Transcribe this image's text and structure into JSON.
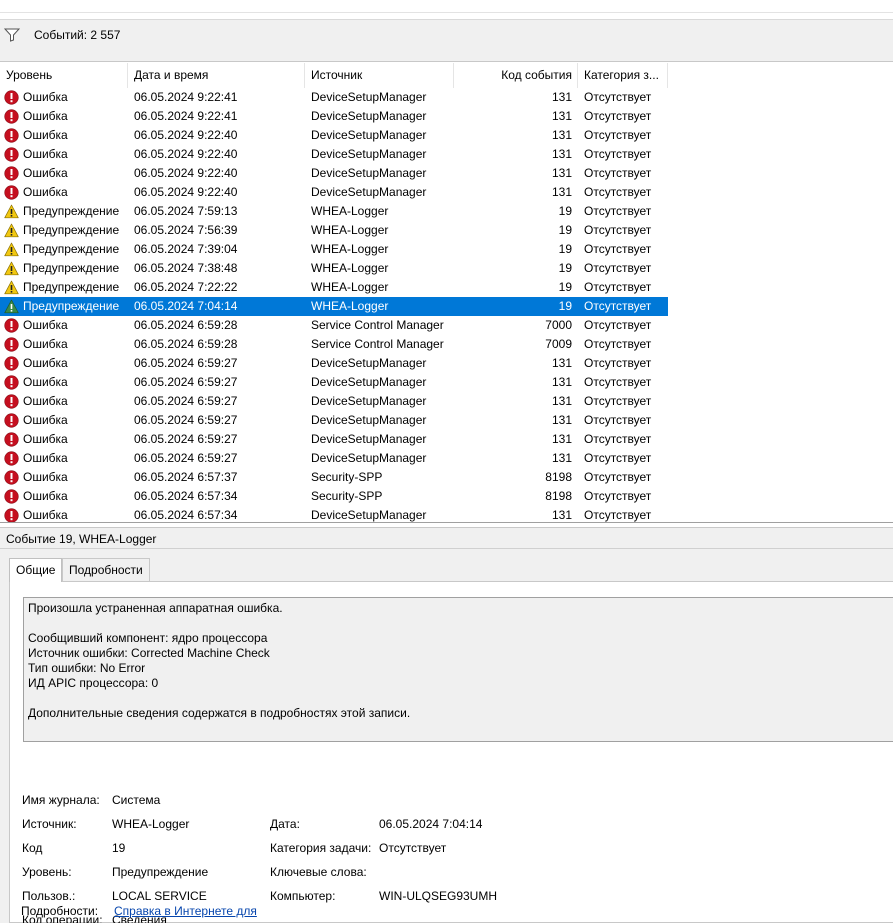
{
  "filter": {
    "icon": "filter-icon",
    "events_count": "Событий: 2 557"
  },
  "table": {
    "headers": {
      "level": "Уровень",
      "date": "Дата и время",
      "source": "Источник",
      "code": "Код события",
      "category": "Категория з..."
    },
    "rows": [
      {
        "level": "Ошибка",
        "type": "error",
        "date": "06.05.2024 9:22:41",
        "source": "DeviceSetupManager",
        "code": "131",
        "category": "Отсутствует"
      },
      {
        "level": "Ошибка",
        "type": "error",
        "date": "06.05.2024 9:22:41",
        "source": "DeviceSetupManager",
        "code": "131",
        "category": "Отсутствует"
      },
      {
        "level": "Ошибка",
        "type": "error",
        "date": "06.05.2024 9:22:40",
        "source": "DeviceSetupManager",
        "code": "131",
        "category": "Отсутствует"
      },
      {
        "level": "Ошибка",
        "type": "error",
        "date": "06.05.2024 9:22:40",
        "source": "DeviceSetupManager",
        "code": "131",
        "category": "Отсутствует"
      },
      {
        "level": "Ошибка",
        "type": "error",
        "date": "06.05.2024 9:22:40",
        "source": "DeviceSetupManager",
        "code": "131",
        "category": "Отсутствует"
      },
      {
        "level": "Ошибка",
        "type": "error",
        "date": "06.05.2024 9:22:40",
        "source": "DeviceSetupManager",
        "code": "131",
        "category": "Отсутствует"
      },
      {
        "level": "Предупреждение",
        "type": "warning",
        "date": "06.05.2024 7:59:13",
        "source": "WHEA-Logger",
        "code": "19",
        "category": "Отсутствует"
      },
      {
        "level": "Предупреждение",
        "type": "warning",
        "date": "06.05.2024 7:56:39",
        "source": "WHEA-Logger",
        "code": "19",
        "category": "Отсутствует"
      },
      {
        "level": "Предупреждение",
        "type": "warning",
        "date": "06.05.2024 7:39:04",
        "source": "WHEA-Logger",
        "code": "19",
        "category": "Отсутствует"
      },
      {
        "level": "Предупреждение",
        "type": "warning",
        "date": "06.05.2024 7:38:48",
        "source": "WHEA-Logger",
        "code": "19",
        "category": "Отсутствует"
      },
      {
        "level": "Предупреждение",
        "type": "warning",
        "date": "06.05.2024 7:22:22",
        "source": "WHEA-Logger",
        "code": "19",
        "category": "Отсутствует"
      },
      {
        "level": "Предупреждение",
        "type": "warning",
        "date": "06.05.2024 7:04:14",
        "source": "WHEA-Logger",
        "code": "19",
        "category": "Отсутствует",
        "selected": true
      },
      {
        "level": "Ошибка",
        "type": "error",
        "date": "06.05.2024 6:59:28",
        "source": "Service Control Manager",
        "code": "7000",
        "category": "Отсутствует"
      },
      {
        "level": "Ошибка",
        "type": "error",
        "date": "06.05.2024 6:59:28",
        "source": "Service Control Manager",
        "code": "7009",
        "category": "Отсутствует"
      },
      {
        "level": "Ошибка",
        "type": "error",
        "date": "06.05.2024 6:59:27",
        "source": "DeviceSetupManager",
        "code": "131",
        "category": "Отсутствует"
      },
      {
        "level": "Ошибка",
        "type": "error",
        "date": "06.05.2024 6:59:27",
        "source": "DeviceSetupManager",
        "code": "131",
        "category": "Отсутствует"
      },
      {
        "level": "Ошибка",
        "type": "error",
        "date": "06.05.2024 6:59:27",
        "source": "DeviceSetupManager",
        "code": "131",
        "category": "Отсутствует"
      },
      {
        "level": "Ошибка",
        "type": "error",
        "date": "06.05.2024 6:59:27",
        "source": "DeviceSetupManager",
        "code": "131",
        "category": "Отсутствует"
      },
      {
        "level": "Ошибка",
        "type": "error",
        "date": "06.05.2024 6:59:27",
        "source": "DeviceSetupManager",
        "code": "131",
        "category": "Отсутствует"
      },
      {
        "level": "Ошибка",
        "type": "error",
        "date": "06.05.2024 6:59:27",
        "source": "DeviceSetupManager",
        "code": "131",
        "category": "Отсутствует"
      },
      {
        "level": "Ошибка",
        "type": "error",
        "date": "06.05.2024 6:57:37",
        "source": "Security-SPP",
        "code": "8198",
        "category": "Отсутствует"
      },
      {
        "level": "Ошибка",
        "type": "error",
        "date": "06.05.2024 6:57:34",
        "source": "Security-SPP",
        "code": "8198",
        "category": "Отсутствует"
      },
      {
        "level": "Ошибка",
        "type": "error",
        "date": "06.05.2024 6:57:34",
        "source": "DeviceSetupManager",
        "code": "131",
        "category": "Отсутствует"
      }
    ]
  },
  "detail": {
    "title": "Событие 19, WHEA-Logger",
    "tabs": {
      "general": "Общие",
      "details": "Подробности"
    },
    "description": [
      "Произошла устраненная аппаратная ошибка.",
      "",
      "Сообщивший компонент: ядро процессора",
      "Источник ошибки: Corrected Machine Check",
      "Тип ошибки: No Error",
      "ИД APIC процессора: 0",
      "",
      "Дополнительные сведения содержатся в подробностях этой записи."
    ],
    "props": {
      "log_name_label": "Имя журнала:",
      "log_name": "Система",
      "source_label": "Источник:",
      "source": "WHEA-Logger",
      "date_label": "Дата:",
      "date": "06.05.2024 7:04:14",
      "code_label": "Код",
      "code": "19",
      "task_cat_label": "Категория задачи:",
      "task_cat": "Отсутствует",
      "level_label": "Уровень:",
      "level": "Предупреждение",
      "keywords_label": "Ключевые слова:",
      "user_label": "Пользов.:",
      "user": "LOCAL SERVICE",
      "computer_label": "Компьютер:",
      "computer": "WIN-ULQSEG93UMH",
      "opcode_label": "Код операции:",
      "opcode": "Сведения",
      "more_label": "Подробности:",
      "more_link": "Справка в Интернете для "
    }
  },
  "colors": {
    "selection": "#0078d7",
    "error": "#c50f1f",
    "warning": "#f2c811",
    "link": "#0645ad"
  }
}
